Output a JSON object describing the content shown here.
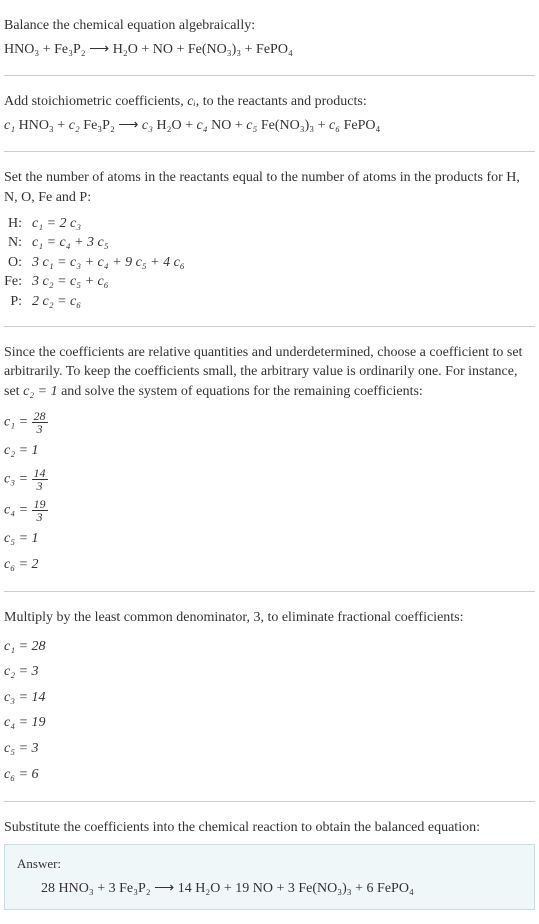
{
  "intro": {
    "line1": "Balance the chemical equation algebraically:",
    "eq": "HNO₃ + Fe₃P₂ ⟶ H₂O + NO + Fe(NO₃)₃ + FePO₄"
  },
  "step1": {
    "text_a": "Add stoichiometric coefficients, ",
    "text_b": ", to the reactants and products:",
    "ci": "cᵢ",
    "eq_parts": {
      "c1": "c₁",
      "r1": " HNO₃ + ",
      "c2": "c₂",
      "r2": " Fe₃P₂ ⟶ ",
      "c3": "c₃",
      "r3": " H₂O + ",
      "c4": "c₄",
      "r4": " NO + ",
      "c5": "c₅",
      "r5": " Fe(NO₃)₃ + ",
      "c6": "c₆",
      "r6": " FePO₄"
    }
  },
  "step2": {
    "text": "Set the number of atoms in the reactants equal to the number of atoms in the products for H, N, O, Fe and P:",
    "rows": [
      {
        "label": "H:",
        "eq": "c₁ = 2 c₃"
      },
      {
        "label": "N:",
        "eq": "c₁ = c₄ + 3 c₅"
      },
      {
        "label": "O:",
        "eq": "3 c₁ = c₃ + c₄ + 9 c₅ + 4 c₆"
      },
      {
        "label": "Fe:",
        "eq": "3 c₂ = c₅ + c₆"
      },
      {
        "label": "P:",
        "eq": "2 c₂ = c₆"
      }
    ]
  },
  "step3": {
    "text_a": "Since the coefficients are relative quantities and underdetermined, choose a coefficient to set arbitrarily. To keep the coefficients small, the arbitrary value is ordinarily one. For instance, set ",
    "text_b": " and solve the system of equations for the remaining coefficients:",
    "c2eq": "c₂ = 1",
    "coefs": [
      {
        "lhs": "c₁ = ",
        "num": "28",
        "den": "3"
      },
      {
        "lhs": "c₂ = 1"
      },
      {
        "lhs": "c₃ = ",
        "num": "14",
        "den": "3"
      },
      {
        "lhs": "c₄ = ",
        "num": "19",
        "den": "3"
      },
      {
        "lhs": "c₅ = 1"
      },
      {
        "lhs": "c₆ = 2"
      }
    ]
  },
  "step4": {
    "text": "Multiply by the least common denominator, 3, to eliminate fractional coefficients:",
    "coefs": [
      "c₁ = 28",
      "c₂ = 3",
      "c₃ = 14",
      "c₄ = 19",
      "c₅ = 3",
      "c₆ = 6"
    ]
  },
  "step5": {
    "text": "Substitute the coefficients into the chemical reaction to obtain the balanced equation:"
  },
  "answer": {
    "label": "Answer:",
    "eq": "28 HNO₃ + 3 Fe₃P₂ ⟶ 14 H₂O + 19 NO + 3 Fe(NO₃)₃ + 6 FePO₄"
  }
}
